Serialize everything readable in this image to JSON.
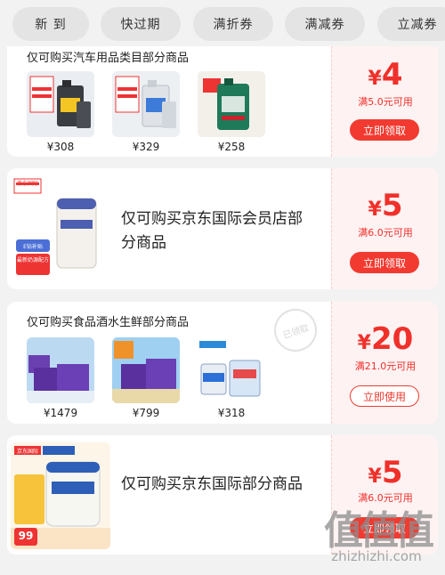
{
  "tabs": [
    "新 到",
    "快过期",
    "满折券",
    "满减券",
    "立减券"
  ],
  "coupons": [
    {
      "scope": "仅可购买汽车用品类目部分商品",
      "products": [
        {
          "price": "¥308",
          "image": "motor-oil-jug"
        },
        {
          "price": "¥329",
          "image": "motor-oil-jug"
        },
        {
          "price": "¥258",
          "image": "motor-oil-jug"
        }
      ],
      "yen": "¥",
      "amount": "4",
      "condition": "满5.0元可用",
      "button": "立即领取"
    },
    {
      "scope": "仅可购买京东国际会员店部分商品",
      "badge": "京东国际",
      "tag1": "E钻补贴",
      "tag2": "最新奶源配方",
      "yen": "¥",
      "amount": "5",
      "condition": "满6.0元可用",
      "button": "立即领取"
    },
    {
      "scope": "仅可购买食品酒水生鲜部分商品",
      "stamp": "已领取",
      "products": [
        {
          "price": "¥1479",
          "image": "milk-powder-box"
        },
        {
          "price": "¥799",
          "image": "milk-powder-box"
        },
        {
          "price": "¥318",
          "image": "milk-powder-can"
        }
      ],
      "yen": "¥",
      "amount": "20",
      "condition": "满21.0元可用",
      "button": "立即使用"
    },
    {
      "scope": "仅可购买京东国际部分商品",
      "badge": "京东国际",
      "tag1": "99",
      "yen": "¥",
      "amount": "5",
      "condition": "满6.0元可用",
      "button": "立即领取"
    }
  ],
  "watermark": {
    "brand": "值",
    "domain": "zhizhizhi.com"
  },
  "colors": {
    "accent": "#f23a30",
    "coupon_bg": "#fff2f2",
    "page_bg": "#f2f2f2"
  }
}
